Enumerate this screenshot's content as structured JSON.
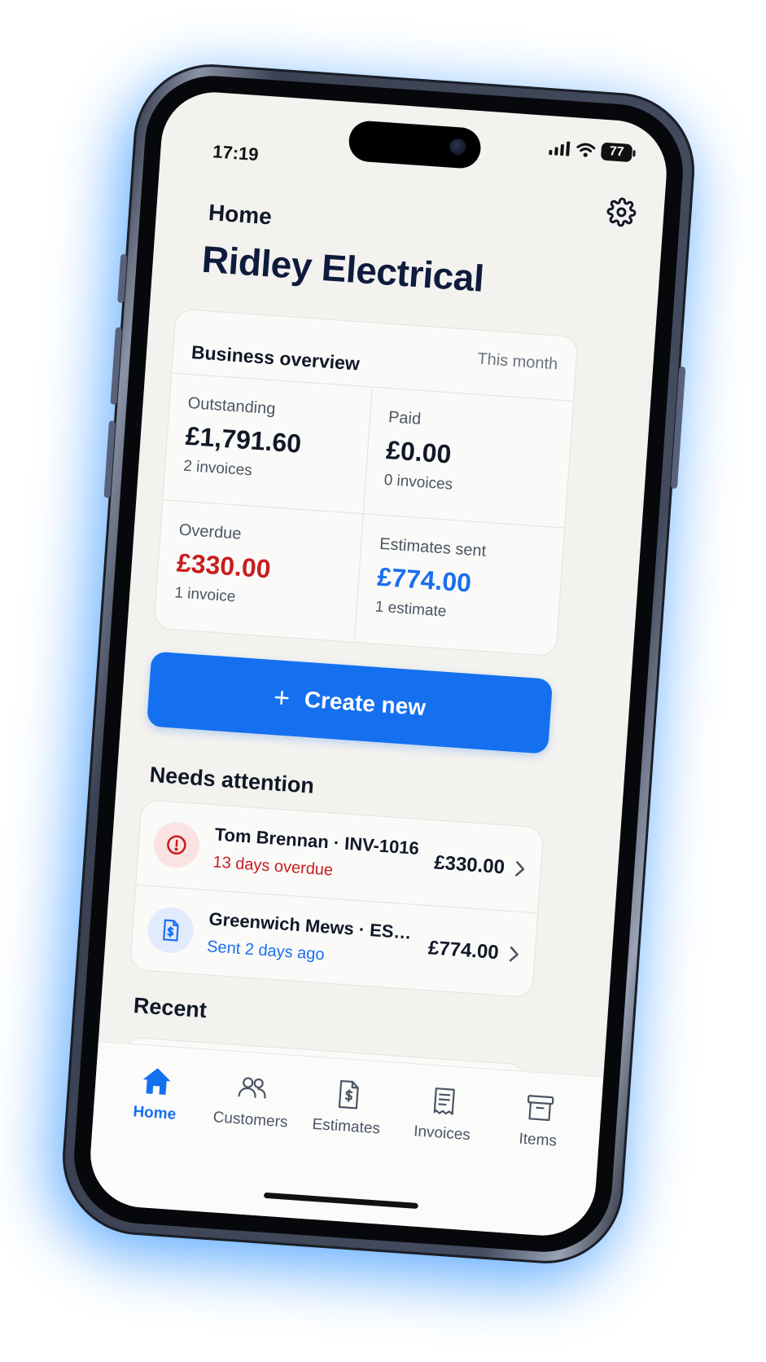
{
  "status_bar": {
    "time": "17:19",
    "battery": "77"
  },
  "header": {
    "nav_title": "Home",
    "business_name": "Ridley Electrical"
  },
  "overview": {
    "title": "Business overview",
    "period": "This month",
    "stats": [
      {
        "label": "Outstanding",
        "amount": "£1,791.60",
        "sub": "2 invoices"
      },
      {
        "label": "Paid",
        "amount": "£0.00",
        "sub": "0 invoices"
      },
      {
        "label": "Overdue",
        "amount": "£330.00",
        "sub": "1 invoice"
      },
      {
        "label": "Estimates sent",
        "amount": "£774.00",
        "sub": "1 estimate"
      }
    ]
  },
  "create_button": {
    "icon": "+",
    "label": "Create new"
  },
  "needs_attention": {
    "title": "Needs attention",
    "items": [
      {
        "icon": "alert-circle-icon",
        "title": "Tom Brennan · INV-1016",
        "sub": "13 days overdue",
        "amount": "£330.00"
      },
      {
        "icon": "estimate-document-icon",
        "title": "Greenwich Mews · EST-...",
        "sub": "Sent 2 days ago",
        "amount": "£774.00"
      }
    ]
  },
  "recent": {
    "title": "Recent"
  },
  "tab_bar": [
    {
      "label": "Home",
      "icon": "home-icon",
      "active": true
    },
    {
      "label": "Customers",
      "icon": "customers-icon",
      "active": false
    },
    {
      "label": "Estimates",
      "icon": "estimates-icon",
      "active": false
    },
    {
      "label": "Invoices",
      "icon": "invoices-icon",
      "active": false
    },
    {
      "label": "Items",
      "icon": "items-icon",
      "active": false
    }
  ],
  "colors": {
    "primary": "#1570f0",
    "overdue_red": "#c81e1e",
    "text_dark": "#111827",
    "glow": "#4aa0ff"
  }
}
